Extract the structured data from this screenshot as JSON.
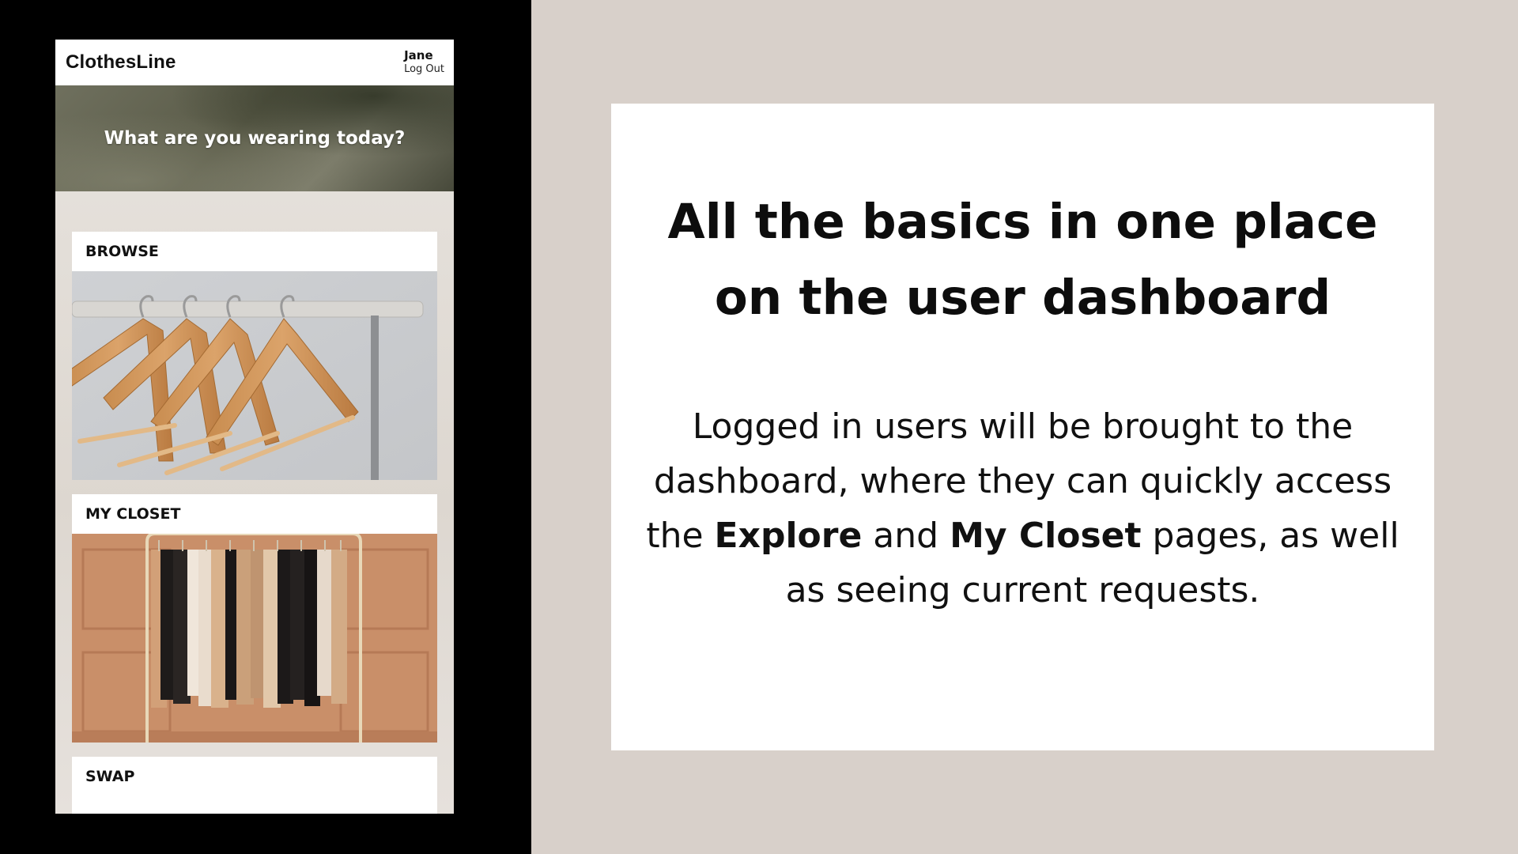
{
  "app": {
    "logo": "ClothesLine",
    "user_name": "Jane",
    "logout_label": "Log Out",
    "hero_text": "What are you wearing today?"
  },
  "cards": {
    "browse_label": "BROWSE",
    "closet_label": "MY CLOSET",
    "swap_label": "SWAP"
  },
  "slide": {
    "headline_line1": "All the basics in one place",
    "headline_line2": "on the user dashboard",
    "body_part1": "Logged in users will be brought to the dashboard, where they can quickly access the ",
    "body_bold1": "Explore",
    "body_part2": " and ",
    "body_bold2": "My Closet",
    "body_part3": " pages, as well as seeing current requests."
  },
  "colors": {
    "page_background": "#d8d0ca",
    "panel_background": "#000000",
    "card_background": "#ffffff",
    "text": "#0d0d0d"
  }
}
